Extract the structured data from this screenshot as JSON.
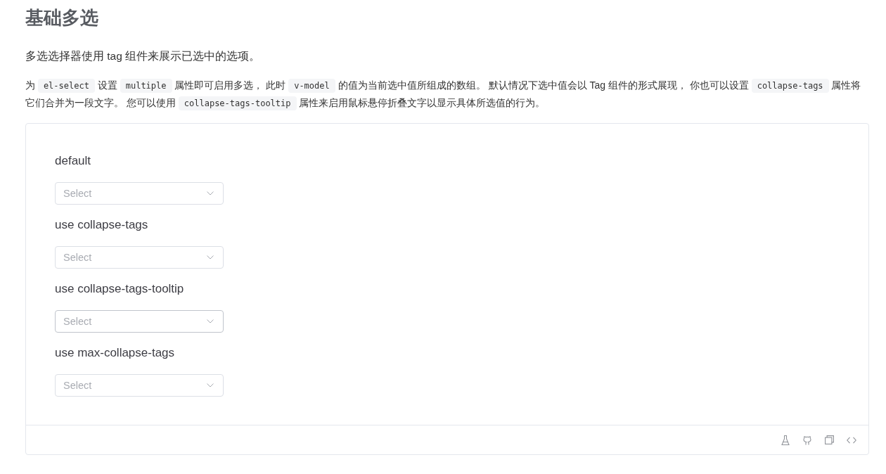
{
  "title": "基础多选",
  "intro": "多选选择器使用 tag 组件来展示已选中的选项。",
  "description": [
    {
      "kind": "text",
      "text": "为 "
    },
    {
      "kind": "code",
      "text": "el-select"
    },
    {
      "kind": "text",
      "text": " 设置 "
    },
    {
      "kind": "code",
      "text": "multiple"
    },
    {
      "kind": "text",
      "text": " 属性即可启用多选， 此时 "
    },
    {
      "kind": "code",
      "text": "v-model"
    },
    {
      "kind": "text",
      "text": " 的值为当前选中值所组成的数组。 默认情况下选中值会以 Tag 组件的形式展现， 你也可以设置 "
    },
    {
      "kind": "code",
      "text": "collapse-tags"
    },
    {
      "kind": "text",
      "text": " 属性将它们合并为一段文字。 您可以使用 "
    },
    {
      "kind": "code",
      "text": "collapse-tags-tooltip"
    },
    {
      "kind": "text",
      "text": " 属性来启用鼠标悬停折叠文字以显示具体所选值的行为。"
    }
  ],
  "demos": [
    {
      "label": "default",
      "placeholder": "Select",
      "hovered": false
    },
    {
      "label": "use collapse-tags",
      "placeholder": "Select",
      "hovered": false
    },
    {
      "label": "use collapse-tags-tooltip",
      "placeholder": "Select",
      "hovered": true
    },
    {
      "label": "use max-collapse-tags",
      "placeholder": "Select",
      "hovered": false
    }
  ]
}
